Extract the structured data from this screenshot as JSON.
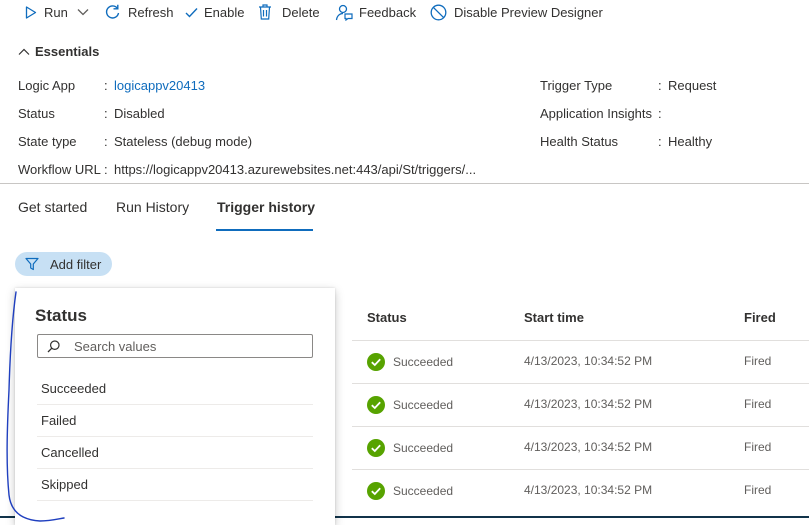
{
  "toolbar": {
    "run_label": "Run",
    "refresh_label": "Refresh",
    "enable_label": "Enable",
    "delete_label": "Delete",
    "feedback_label": "Feedback",
    "disable_preview_label": "Disable Preview Designer"
  },
  "essentials": {
    "title": "Essentials",
    "logic_app_label": "Logic App",
    "logic_app_value": "logicappv20413",
    "status_label": "Status",
    "status_value": "Disabled",
    "state_type_label": "State type",
    "state_type_value": "Stateless (debug mode)",
    "workflow_url_label": "Workflow URL",
    "workflow_url_value": "https://logicappv20413.azurewebsites.net:443/api/St/triggers/...",
    "trigger_type_label": "Trigger Type",
    "trigger_type_value": "Request",
    "app_insights_label": "Application Insights",
    "app_insights_value": "",
    "health_status_label": "Health Status",
    "health_status_value": "Healthy",
    "separator": ":"
  },
  "tabs": [
    {
      "label": "Get started",
      "active": false
    },
    {
      "label": "Run History",
      "active": false
    },
    {
      "label": "Trigger history",
      "active": true
    }
  ],
  "filter": {
    "add_filter_label": "Add filter"
  },
  "filter_panel": {
    "title": "Status",
    "search_placeholder": "Search values",
    "options": [
      "Succeeded",
      "Failed",
      "Cancelled",
      "Skipped"
    ]
  },
  "table": {
    "columns": [
      "Status",
      "Start time",
      "Fired"
    ],
    "rows": [
      {
        "status": "Succeeded",
        "start_time": "4/13/2023, 10:34:52 PM",
        "fired": "Fired"
      },
      {
        "status": "Succeeded",
        "start_time": "4/13/2023, 10:34:52 PM",
        "fired": "Fired"
      },
      {
        "status": "Succeeded",
        "start_time": "4/13/2023, 10:34:52 PM",
        "fired": "Fired"
      },
      {
        "status": "Succeeded",
        "start_time": "4/13/2023, 10:34:52 PM",
        "fired": "Fired"
      }
    ]
  },
  "colors": {
    "accent": "#0f6cbd",
    "success": "#57a300",
    "pill_bg": "#c7e0f4",
    "annotation": "#1f3fbf"
  }
}
